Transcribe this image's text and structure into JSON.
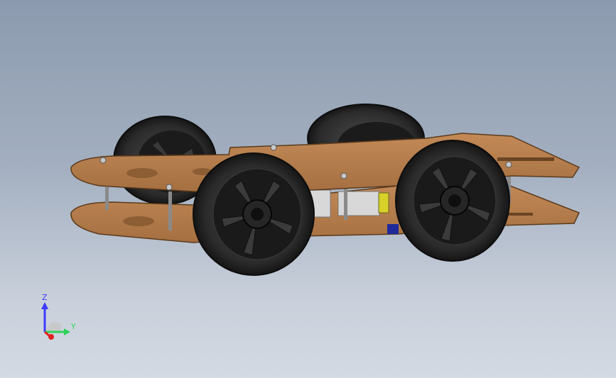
{
  "viewport": {
    "background_top": "#8b9aae",
    "background_bottom": "#d4dae3"
  },
  "model": {
    "plate_color": "#b07a4c",
    "plate_edge_color": "#5a3a1c",
    "tire_color": "#2a2a2a",
    "rim_color": "#111111",
    "motor_yellow": "#d7d12a",
    "motor_blue": "#1f2a9a",
    "motor_body": "#d8d8d8"
  },
  "triad": {
    "z_label": "Z",
    "y_label": "Y",
    "z_color": "#3b3bff",
    "y_color": "#2fd25a",
    "x_color": "#e02020"
  }
}
